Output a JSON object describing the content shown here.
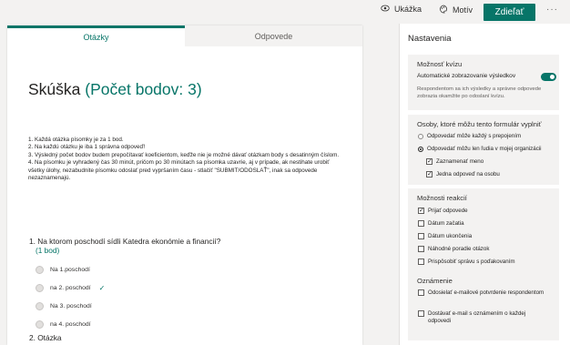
{
  "toolbar": {
    "preview_label": "Ukážka",
    "theme_label": "Motív",
    "share_label": "Zdieľať",
    "more_label": "···"
  },
  "tabs": {
    "questions": "Otázky",
    "responses": "Odpovede"
  },
  "form": {
    "title": "Skúška",
    "points": "(Počet bodov: 3)",
    "description": [
      "1. Každá otázka písomky je za 1 bod.",
      "2. Na každú otázku je iba 1 správna odpoveď!",
      "3. Výsledný počet bodov budem prepočítavať koeficientom, keďže nie je možné dávať otázkam body s desatinným číslom.",
      "4. Na písomku je vyhradený čas 30 minút, pričom po 30 minútach sa písomka uzavrie, aj v prípade, ak nestihate urobiť všetky úlohy, nezabudnite písomku odoslať pred vypršaním času - stlačiť \"SUBMIT/ODOSLAŤ\", inak sa odpovede nezaznamenajú."
    ],
    "question1": {
      "text": "1. Na ktorom poschodí sídli Katedra ekonómie a financií?",
      "points": "(1 bod)",
      "options": [
        "Na 1.poschodí",
        "na 2. poschodí",
        "Na 3. poschodí",
        "na 4. poschodí"
      ],
      "correct_mark": "✓"
    },
    "question2": {
      "text": "2. Otázka"
    }
  },
  "settings": {
    "title": "Nastavenia",
    "quiz": {
      "heading": "Možnosť kvízu",
      "auto_results_label": "Automatické zobrazovanie výsledkov",
      "auto_results_on": true,
      "note": "Respondentom sa ich výsledky a správne odpovede zobrazia okamžite po odoslaní kvízu."
    },
    "who": {
      "heading": "Osoby, ktoré môžu tento formulár vyplniť",
      "option_anyone": "Odpovedať môže každý s prepojením",
      "option_org": "Odpovedať môžu len ľudia v mojej organizácii",
      "record_name": "Zaznamenať meno",
      "one_response": "Jedna odpoveď na osobu"
    },
    "responses": {
      "heading": "Možnosti reakcií",
      "accept": "Prijať odpovede",
      "start_date": "Dátum začatia",
      "end_date": "Dátum ukončenia",
      "shuffle": "Náhodné poradie otázok",
      "customize": "Prispôsobiť správu s poďakovaním"
    },
    "notifications": {
      "heading": "Oznámenie",
      "email_confirm": "Odosielať e-mailové potvrdenie respondentom",
      "email_notify": "Dostávať e-mail s oznámením o každej odpovedi"
    }
  }
}
